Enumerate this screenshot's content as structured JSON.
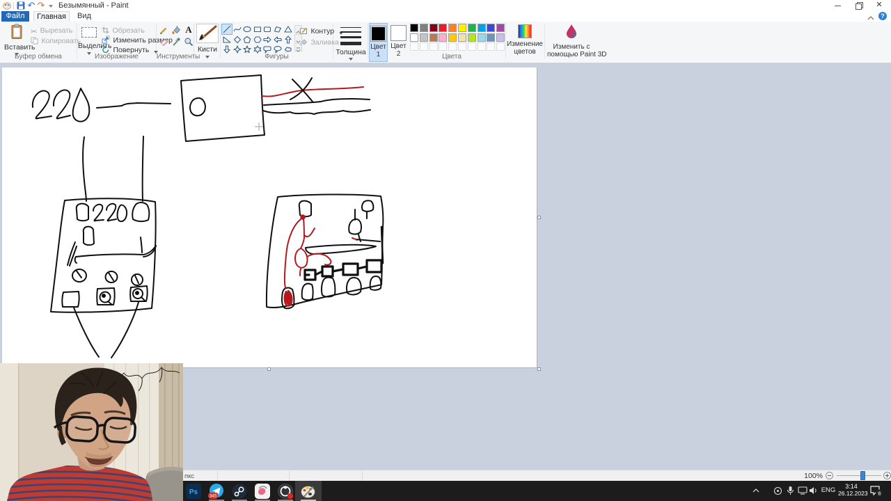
{
  "titlebar": {
    "title": "Безымянный - Paint"
  },
  "tabs": {
    "file": "Файл",
    "home": "Главная",
    "view": "Вид"
  },
  "ribbon": {
    "paste": "Вставить",
    "cut": "Вырезать",
    "copy": "Копировать",
    "clipboard_group": "Буфер обмена",
    "select": "Выделить",
    "crop": "Обрезать",
    "resize": "Изменить размер",
    "rotate": "Повернуть",
    "image_group": "Изображение",
    "tools_group": "Инструменты",
    "brushes": "Кисти",
    "outline": "Контур",
    "fill": "Заливка",
    "shapes_group": "Фигуры",
    "size": "Толщина",
    "color1_line1": "Цвет",
    "color1_line2": "1",
    "color2_line1": "Цвет",
    "color2_line2": "2",
    "edit_colors_line1": "Изменение",
    "edit_colors_line2": "цветов",
    "colors_group": "Цвета",
    "paint3d_line1": "Изменить с",
    "paint3d_line2": "помощью Paint 3D"
  },
  "palette": {
    "row1": [
      "#000000",
      "#7f7f7f",
      "#880015",
      "#ed1c24",
      "#ff7f27",
      "#fff200",
      "#22b14c",
      "#00a2e8",
      "#3f48cc",
      "#a349a4"
    ],
    "row2": [
      "#ffffff",
      "#c3c3c3",
      "#b97a57",
      "#ffaec9",
      "#ffc90e",
      "#efe4b0",
      "#b5e61d",
      "#99d9ea",
      "#7092be",
      "#c8bfe7"
    ],
    "empty_count": 10
  },
  "shapes": [
    "line",
    "curve",
    "ellipse",
    "rectangle",
    "rounded-rectangle",
    "polygon",
    "triangle",
    "right-triangle",
    "diamond",
    "pentagon",
    "hexagon",
    "arrow-right",
    "arrow-left",
    "arrow-up",
    "arrow-down",
    "star-4",
    "star-5",
    "star-6",
    "callout-rounded",
    "callout-oval",
    "callout-cloud"
  ],
  "canvas": {
    "label_source": "220",
    "label_panel": "220"
  },
  "statusbar": {
    "fragment": "пкс",
    "zoom": "100%"
  },
  "taskbar": {
    "photoshop_label": "Ps",
    "telegram_badge": "345",
    "tray": {
      "lang": "ENG",
      "time": "3:14",
      "date": "26.12.2023",
      "notif_count": "6"
    }
  }
}
